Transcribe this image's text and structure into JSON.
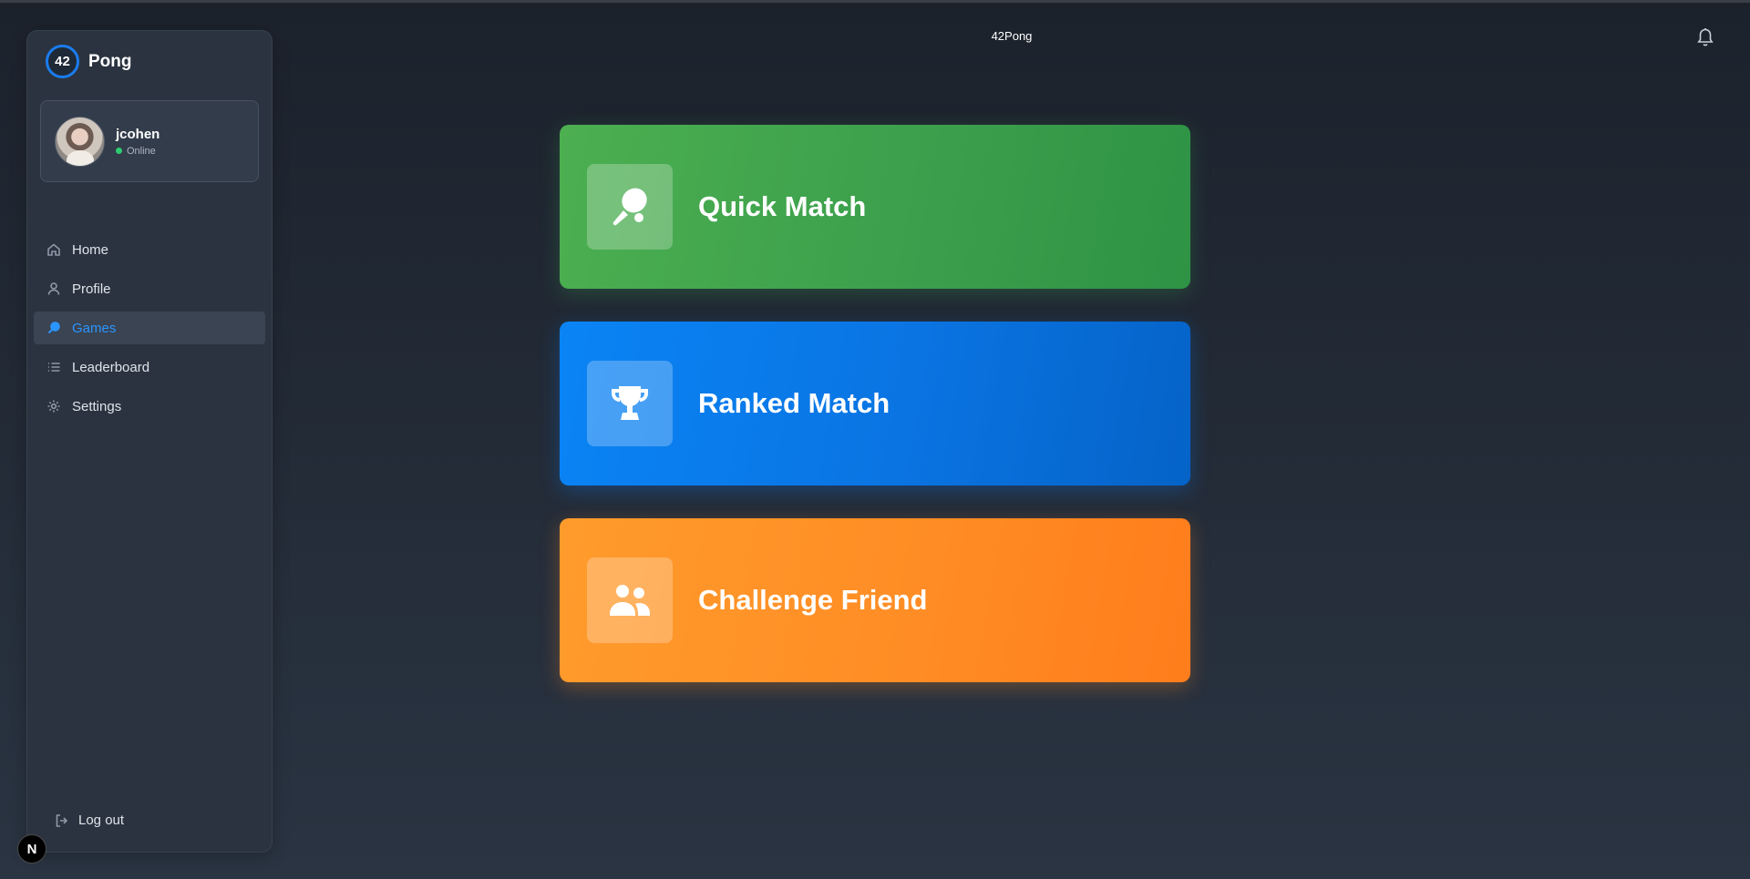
{
  "app": {
    "brand_badge": "42",
    "brand_name": "Pong",
    "header_title": "42Pong"
  },
  "user": {
    "name": "jcohen",
    "status": "Online"
  },
  "sidebar": {
    "items": [
      {
        "label": "Home",
        "icon": "home-icon"
      },
      {
        "label": "Profile",
        "icon": "user-icon"
      },
      {
        "label": "Games",
        "icon": "paddle-icon",
        "active": true
      },
      {
        "label": "Leaderboard",
        "icon": "list-icon"
      },
      {
        "label": "Settings",
        "icon": "gear-icon"
      }
    ],
    "logout_label": "Log out"
  },
  "games": [
    {
      "label": "Quick Match",
      "icon": "ping-pong-paddle-icon",
      "color": "#4caf50"
    },
    {
      "label": "Ranked Match",
      "icon": "trophy-icon",
      "color": "#0a84f5"
    },
    {
      "label": "Challenge Friend",
      "icon": "users-icon",
      "color": "#ff9b2c"
    }
  ],
  "dev_badge": "N",
  "colors": {
    "accent": "#2b95ff",
    "status_online": "#2ecc71"
  }
}
